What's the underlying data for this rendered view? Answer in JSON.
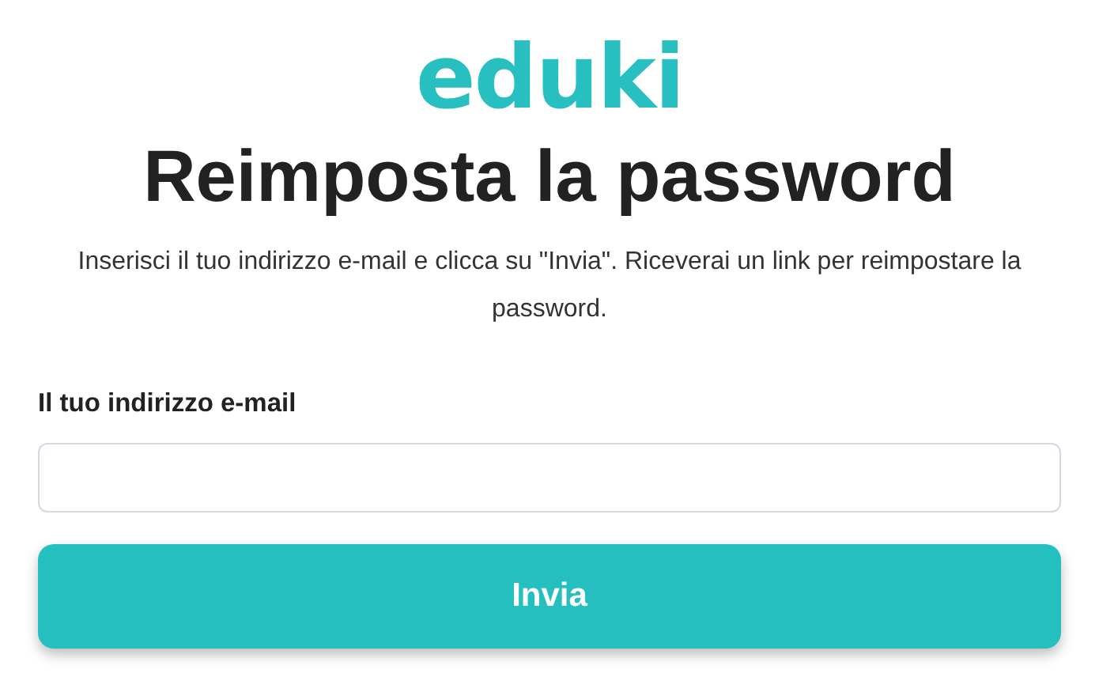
{
  "logo": "eduki",
  "title": "Reimposta la password",
  "description": "Inserisci il tuo indirizzo e-mail e clicca su \"Invia\". Riceverai un link per reimpostare la password.",
  "email_field": {
    "label": "Il tuo indirizzo e-mail"
  },
  "submit_button": "Invia"
}
